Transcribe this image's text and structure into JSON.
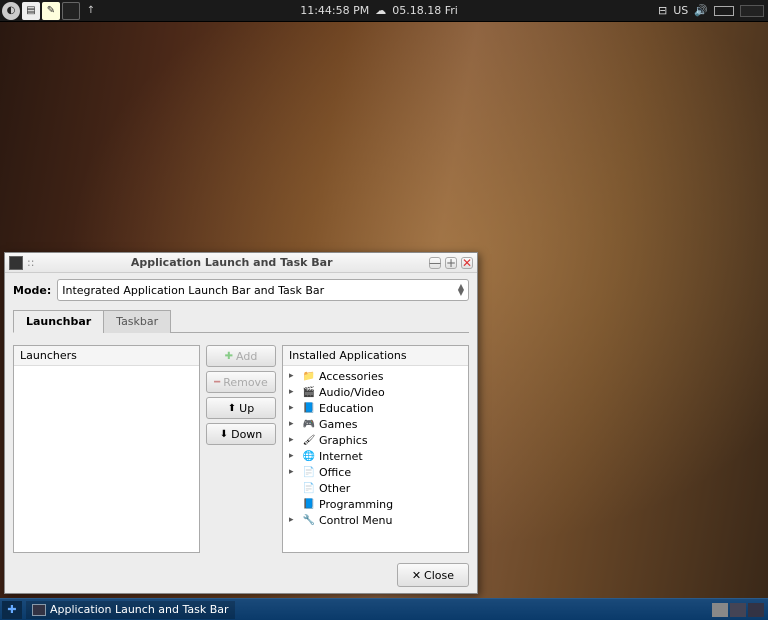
{
  "top_panel": {
    "time": "11:44:58 PM",
    "date": "05.18.18 Fri",
    "kbd": "US"
  },
  "dialog": {
    "title_prefix": "::",
    "title": "Application Launch and Task Bar",
    "mode_label": "Mode:",
    "mode_value": "Integrated Application Launch Bar and Task Bar",
    "tabs": {
      "launchbar": "Launchbar",
      "taskbar": "Taskbar"
    },
    "launchers_header": "Launchers",
    "installed_header": "Installed Applications",
    "buttons": {
      "add": "Add",
      "remove": "Remove",
      "up": "Up",
      "down": "Down"
    },
    "categories": [
      {
        "label": "Accessories",
        "expandable": true
      },
      {
        "label": "Audio/Video",
        "expandable": true
      },
      {
        "label": "Education",
        "expandable": true
      },
      {
        "label": "Games",
        "expandable": true
      },
      {
        "label": "Graphics",
        "expandable": true
      },
      {
        "label": "Internet",
        "expandable": true
      },
      {
        "label": "Office",
        "expandable": true
      },
      {
        "label": "Other",
        "expandable": false
      },
      {
        "label": "Programming",
        "expandable": false
      },
      {
        "label": "Control Menu",
        "expandable": true
      }
    ],
    "close": "Close"
  },
  "taskbar": {
    "app": "Application Launch and Task Bar"
  }
}
